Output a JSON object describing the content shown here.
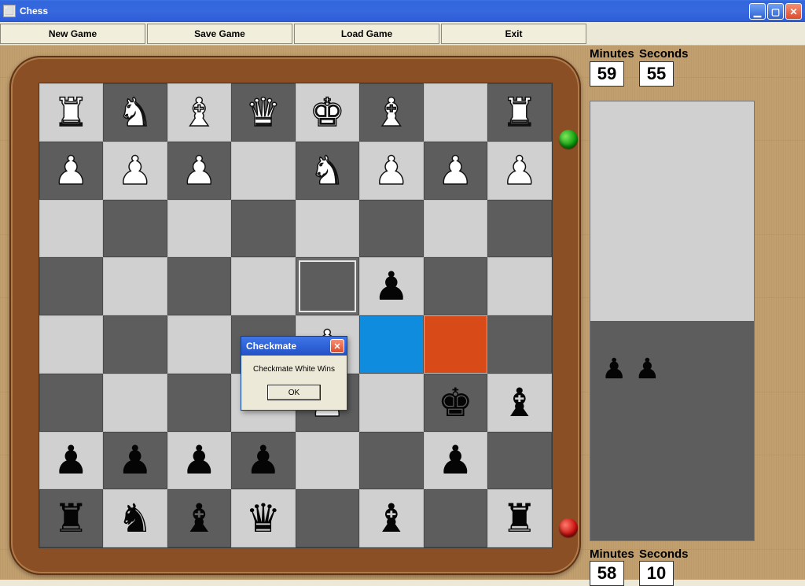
{
  "window": {
    "title": "Chess"
  },
  "toolbar": {
    "new_game": "New Game",
    "save_game": "Save Game",
    "load_game": "Load Game",
    "exit": "Exit"
  },
  "clock": {
    "label_min": "Minutes",
    "label_sec": "Seconds",
    "top": {
      "minutes": "59",
      "seconds": "55"
    },
    "bottom": {
      "minutes": "58",
      "seconds": "10"
    }
  },
  "captured": {
    "black": [
      "♟",
      "♟"
    ]
  },
  "board": {
    "highlights": {
      "from": "e5",
      "selected": "f4",
      "target": "g4"
    },
    "rows": [
      [
        {
          "p": "♜",
          "c": "w"
        },
        {
          "p": "♞",
          "c": "w"
        },
        {
          "p": "♝",
          "c": "w"
        },
        {
          "p": "♛",
          "c": "w"
        },
        {
          "p": "♚",
          "c": "w"
        },
        {
          "p": "♝",
          "c": "w"
        },
        null,
        {
          "p": "♜",
          "c": "w"
        }
      ],
      [
        {
          "p": "♟",
          "c": "w"
        },
        {
          "p": "♟",
          "c": "w"
        },
        {
          "p": "♟",
          "c": "w"
        },
        null,
        {
          "p": "♞",
          "c": "w"
        },
        {
          "p": "♟",
          "c": "w"
        },
        {
          "p": "♟",
          "c": "w"
        },
        {
          "p": "♟",
          "c": "w"
        }
      ],
      [
        null,
        null,
        null,
        null,
        null,
        null,
        null,
        null
      ],
      [
        null,
        null,
        null,
        null,
        null,
        {
          "p": "♟",
          "c": "b"
        },
        null,
        null
      ],
      [
        null,
        null,
        null,
        null,
        {
          "p": "♟",
          "c": "w"
        },
        null,
        null,
        null
      ],
      [
        null,
        null,
        null,
        null,
        {
          "p": "♟",
          "c": "w"
        },
        null,
        {
          "p": "♚",
          "c": "b"
        },
        {
          "p": "♝",
          "c": "b"
        }
      ],
      [
        {
          "p": "♟",
          "c": "b"
        },
        {
          "p": "♟",
          "c": "b"
        },
        {
          "p": "♟",
          "c": "b"
        },
        {
          "p": "♟",
          "c": "b"
        },
        null,
        null,
        {
          "p": "♟",
          "c": "b"
        },
        null
      ],
      [
        {
          "p": "♜",
          "c": "b"
        },
        {
          "p": "♞",
          "c": "b"
        },
        {
          "p": "♝",
          "c": "b"
        },
        {
          "p": "♛",
          "c": "b"
        },
        null,
        {
          "p": "♝",
          "c": "b"
        },
        null,
        {
          "p": "♜",
          "c": "b"
        }
      ]
    ]
  },
  "dialog": {
    "title": "Checkmate",
    "message": "Checkmate White Wins",
    "ok": "OK"
  }
}
